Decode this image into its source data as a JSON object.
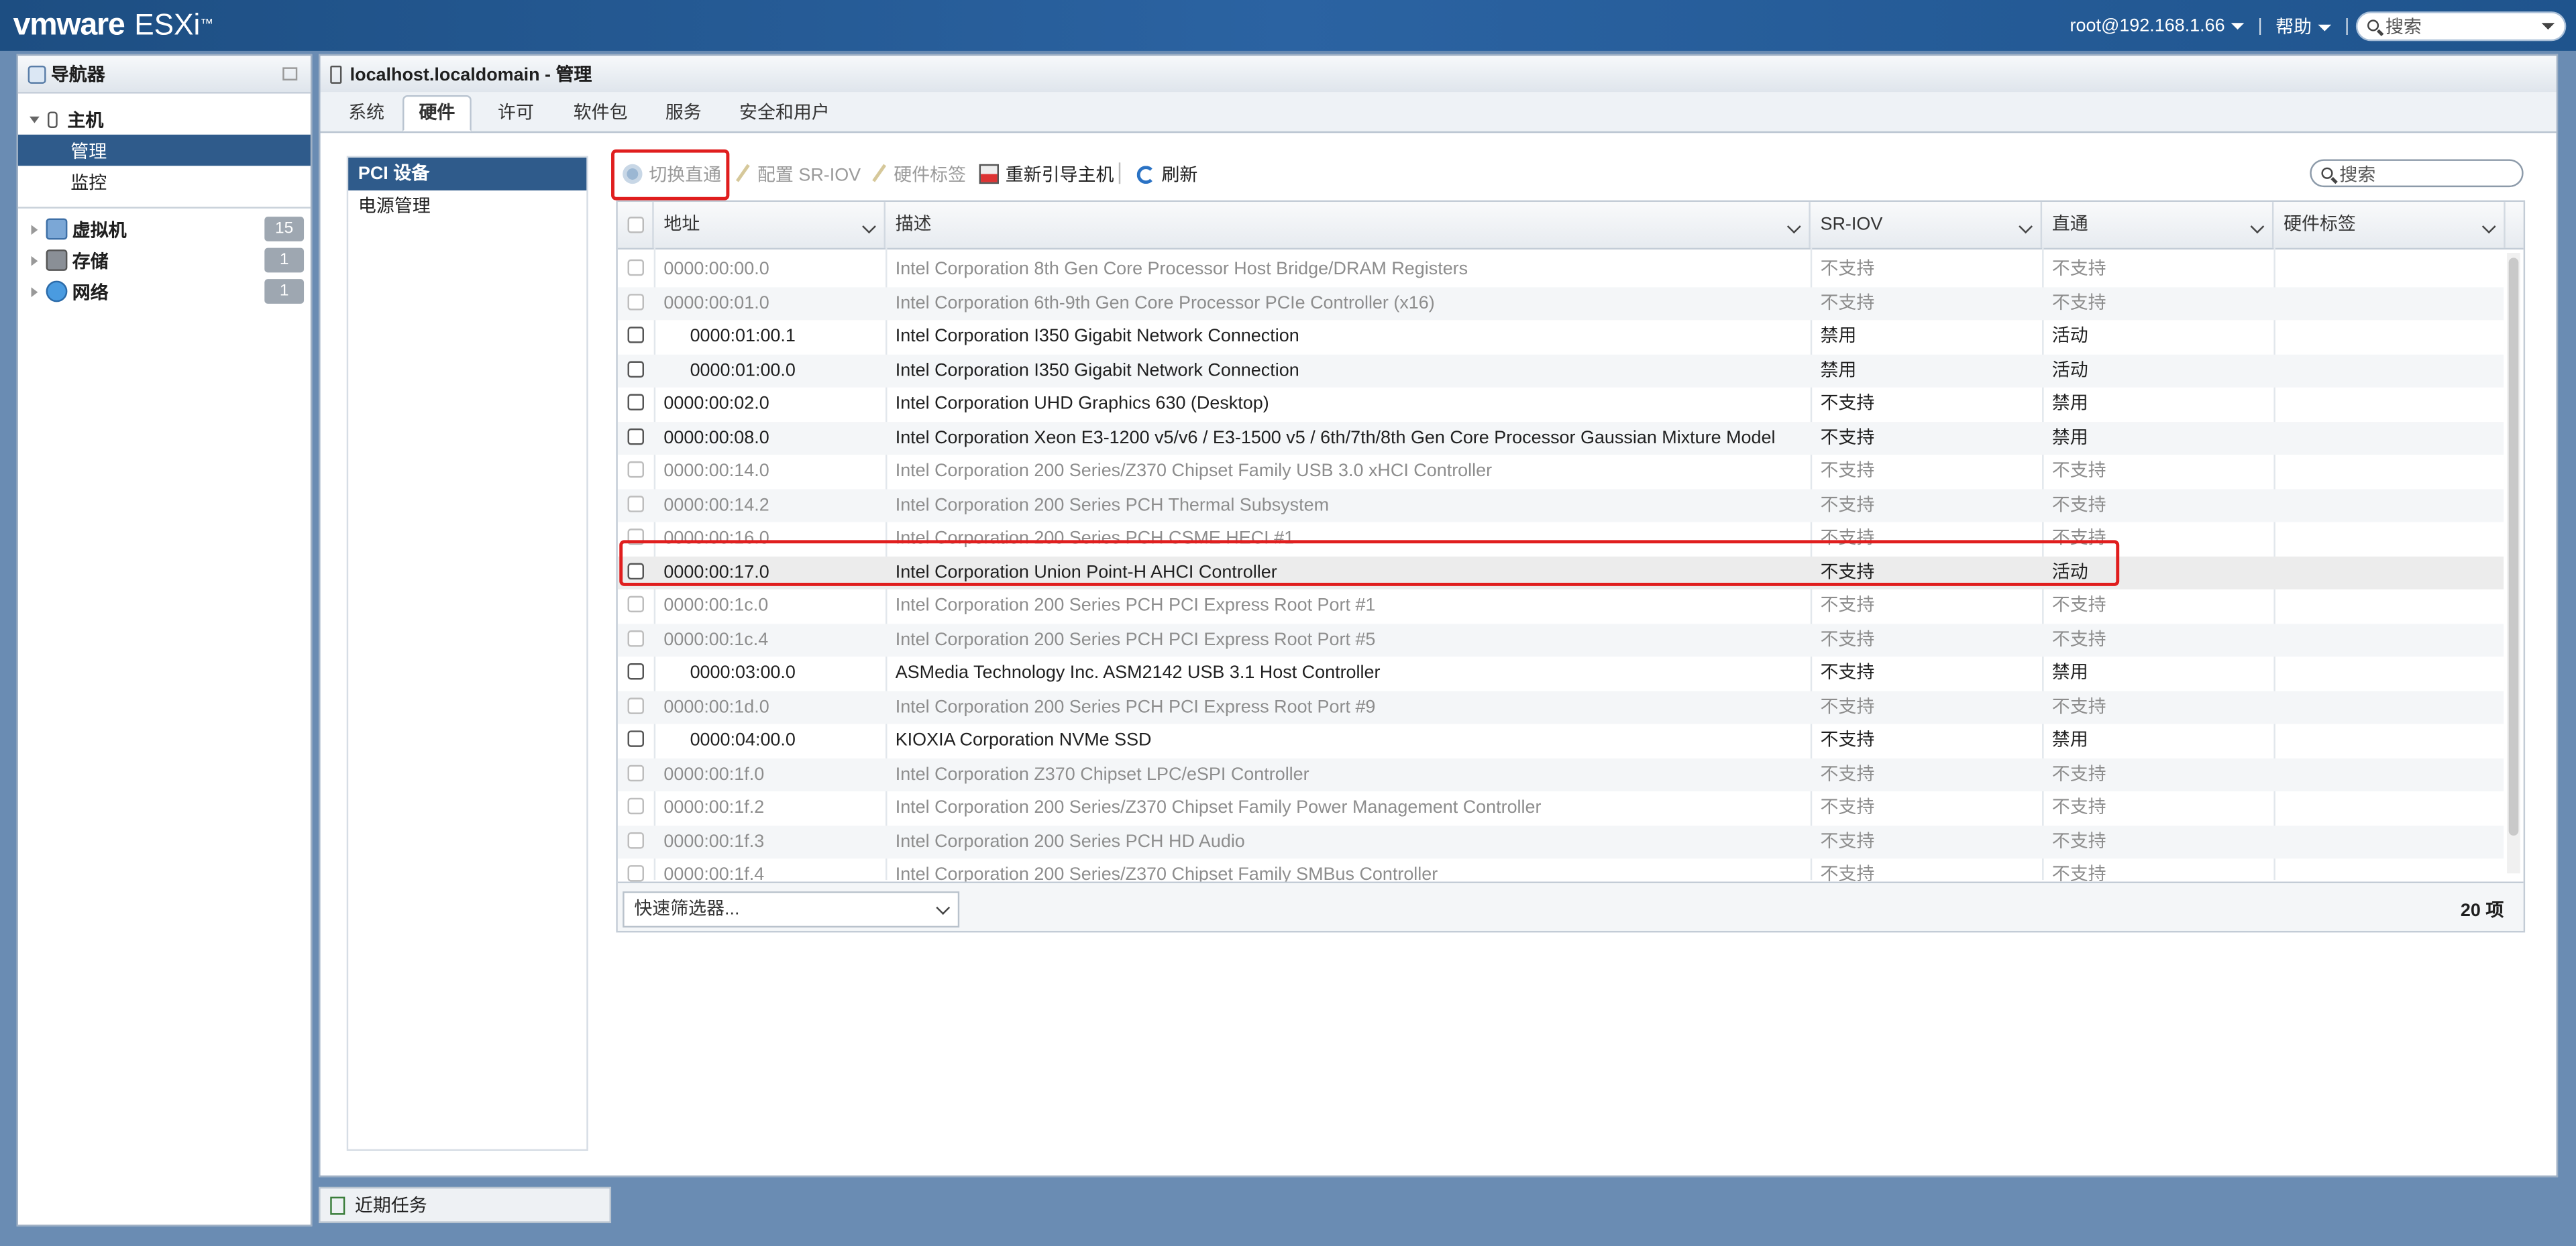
{
  "app": {
    "brand": "vmware",
    "product": "ESXi",
    "tm": "™"
  },
  "topbar": {
    "user": "root@192.168.1.66",
    "help": "帮助",
    "search_placeholder": "搜索"
  },
  "navigator": {
    "title": "导航器",
    "host": {
      "label": "主机",
      "children": [
        "管理",
        "监控"
      ],
      "selected": "管理"
    },
    "items": [
      {
        "label": "虚拟机",
        "badge": "15"
      },
      {
        "label": "存储",
        "badge": "1"
      },
      {
        "label": "网络",
        "badge": "1"
      }
    ]
  },
  "main": {
    "title": "localhost.localdomain - 管理",
    "tabs": [
      "系统",
      "硬件",
      "许可",
      "软件包",
      "服务",
      "安全和用户"
    ],
    "active_tab": "硬件",
    "submenu": [
      "PCI 设备",
      "电源管理"
    ],
    "toolbar": {
      "toggle_passthrough": "切换直通",
      "configure_sriov": "配置 SR-IOV",
      "hardware_label": "硬件标签",
      "reboot_host": "重新引导主机",
      "refresh": "刷新",
      "search_placeholder": "搜索"
    },
    "grid": {
      "columns": [
        "地址",
        "描述",
        "SR-IOV",
        "直通",
        "硬件标签"
      ],
      "rows": [
        {
          "address": "0000:00:00.0",
          "description": "Intel Corporation 8th Gen Core Processor Host Bridge/DRAM Registers",
          "sriov": "不支持",
          "passthrough": "不支持",
          "label": "",
          "enabled": false,
          "indent": false
        },
        {
          "address": "0000:00:01.0",
          "description": "Intel Corporation 6th-9th Gen Core Processor PCIe Controller (x16)",
          "sriov": "不支持",
          "passthrough": "不支持",
          "label": "",
          "enabled": false,
          "indent": false
        },
        {
          "address": "0000:01:00.1",
          "description": "Intel Corporation I350 Gigabit Network Connection",
          "sriov": "禁用",
          "passthrough": "活动",
          "label": "",
          "enabled": true,
          "indent": true
        },
        {
          "address": "0000:01:00.0",
          "description": "Intel Corporation I350 Gigabit Network Connection",
          "sriov": "禁用",
          "passthrough": "活动",
          "label": "",
          "enabled": true,
          "indent": true
        },
        {
          "address": "0000:00:02.0",
          "description": "Intel Corporation UHD Graphics 630 (Desktop)",
          "sriov": "不支持",
          "passthrough": "禁用",
          "label": "",
          "enabled": true,
          "indent": false
        },
        {
          "address": "0000:00:08.0",
          "description": "Intel Corporation Xeon E3-1200 v5/v6 / E3-1500 v5 / 6th/7th/8th Gen Core Processor Gaussian Mixture Model",
          "sriov": "不支持",
          "passthrough": "禁用",
          "label": "",
          "enabled": true,
          "indent": false
        },
        {
          "address": "0000:00:14.0",
          "description": "Intel Corporation 200 Series/Z370 Chipset Family USB 3.0 xHCI Controller",
          "sriov": "不支持",
          "passthrough": "不支持",
          "label": "",
          "enabled": false,
          "indent": false
        },
        {
          "address": "0000:00:14.2",
          "description": "Intel Corporation 200 Series PCH Thermal Subsystem",
          "sriov": "不支持",
          "passthrough": "不支持",
          "label": "",
          "enabled": false,
          "indent": false
        },
        {
          "address": "0000:00:16.0",
          "description": "Intel Corporation 200 Series PCH CSME HECI #1",
          "sriov": "不支持",
          "passthrough": "不支持",
          "label": "",
          "enabled": false,
          "indent": false
        },
        {
          "address": "0000:00:17.0",
          "description": "Intel Corporation Union Point-H AHCI Controller",
          "sriov": "不支持",
          "passthrough": "活动",
          "label": "",
          "enabled": true,
          "indent": false,
          "highlighted": true
        },
        {
          "address": "0000:00:1c.0",
          "description": "Intel Corporation 200 Series PCH PCI Express Root Port #1",
          "sriov": "不支持",
          "passthrough": "不支持",
          "label": "",
          "enabled": false,
          "indent": false
        },
        {
          "address": "0000:00:1c.4",
          "description": "Intel Corporation 200 Series PCH PCI Express Root Port #5",
          "sriov": "不支持",
          "passthrough": "不支持",
          "label": "",
          "enabled": false,
          "indent": false
        },
        {
          "address": "0000:03:00.0",
          "description": "ASMedia Technology Inc. ASM2142 USB 3.1 Host Controller",
          "sriov": "不支持",
          "passthrough": "禁用",
          "label": "",
          "enabled": true,
          "indent": true
        },
        {
          "address": "0000:00:1d.0",
          "description": "Intel Corporation 200 Series PCH PCI Express Root Port #9",
          "sriov": "不支持",
          "passthrough": "不支持",
          "label": "",
          "enabled": false,
          "indent": false
        },
        {
          "address": "0000:04:00.0",
          "description": "KIOXIA Corporation NVMe SSD",
          "sriov": "不支持",
          "passthrough": "禁用",
          "label": "",
          "enabled": true,
          "indent": true
        },
        {
          "address": "0000:00:1f.0",
          "description": "Intel Corporation Z370 Chipset LPC/eSPI Controller",
          "sriov": "不支持",
          "passthrough": "不支持",
          "label": "",
          "enabled": false,
          "indent": false
        },
        {
          "address": "0000:00:1f.2",
          "description": "Intel Corporation 200 Series/Z370 Chipset Family Power Management Controller",
          "sriov": "不支持",
          "passthrough": "不支持",
          "label": "",
          "enabled": false,
          "indent": false
        },
        {
          "address": "0000:00:1f.3",
          "description": "Intel Corporation 200 Series PCH HD Audio",
          "sriov": "不支持",
          "passthrough": "不支持",
          "label": "",
          "enabled": false,
          "indent": false
        },
        {
          "address": "0000:00:1f.4",
          "description": "Intel Corporation 200 Series/Z370 Chipset Family SMBus Controller",
          "sriov": "不支持",
          "passthrough": "不支持",
          "label": "",
          "enabled": false,
          "indent": false
        }
      ],
      "quick_filter": "快速筛选器...",
      "count": "20 项"
    }
  },
  "recent_tasks": "近期任务",
  "colors": {
    "accent": "#2f5b8b",
    "highlight_box": "#e01e1e",
    "topbar": "#2b63a2"
  }
}
